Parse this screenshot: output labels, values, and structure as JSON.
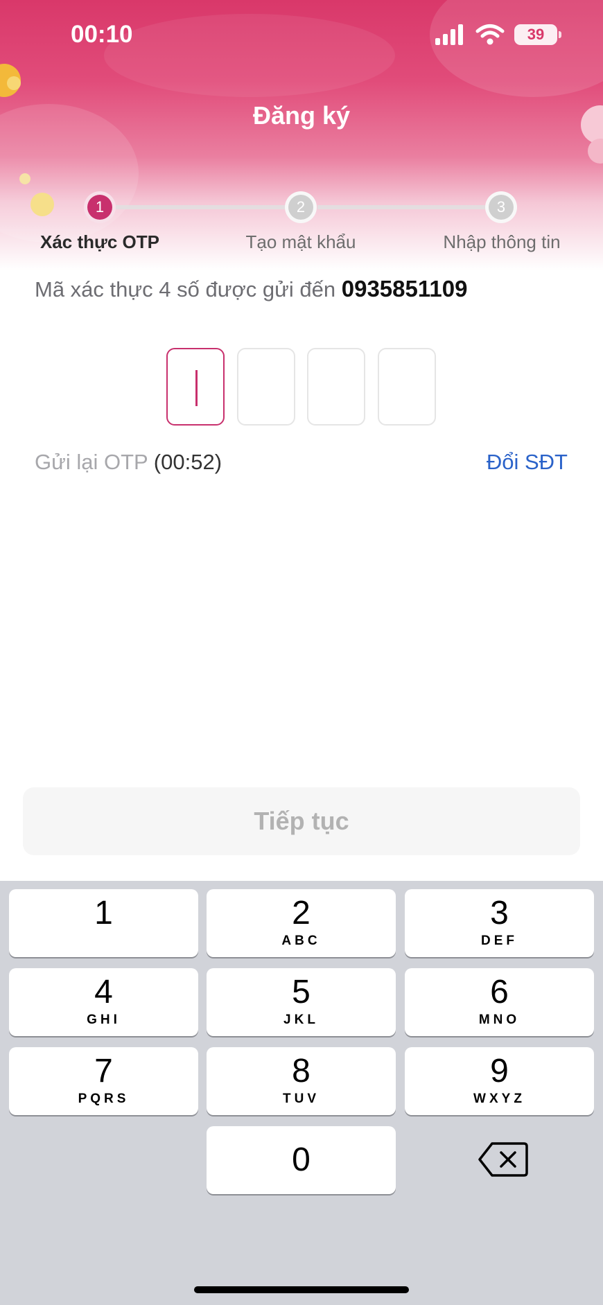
{
  "status_bar": {
    "time": "00:10",
    "battery": "39",
    "icons": [
      "signal-icon",
      "wifi-icon",
      "battery-icon"
    ]
  },
  "header": {
    "title": "Đăng ký"
  },
  "steps": [
    {
      "number": "1",
      "label": "Xác thực OTP",
      "active": true
    },
    {
      "number": "2",
      "label": "Tạo mật khẩu",
      "active": false
    },
    {
      "number": "3",
      "label": "Nhập thông tin",
      "active": false
    }
  ],
  "otp": {
    "message": "Mã xác thực 4 số được gửi đến",
    "phone": "0935851109",
    "digits": [
      "",
      "",
      "",
      ""
    ]
  },
  "resend": {
    "label": "Gửi lại OTP",
    "timer": "(00:52)"
  },
  "change_phone": "Đổi SĐT",
  "continue_label": "Tiếp tục",
  "keyboard": {
    "keys": [
      {
        "num": "1",
        "letters": ""
      },
      {
        "num": "2",
        "letters": "ABC"
      },
      {
        "num": "3",
        "letters": "DEF"
      },
      {
        "num": "4",
        "letters": "GHI"
      },
      {
        "num": "5",
        "letters": "JKL"
      },
      {
        "num": "6",
        "letters": "MNO"
      },
      {
        "num": "7",
        "letters": "PQRS"
      },
      {
        "num": "8",
        "letters": "TUV"
      },
      {
        "num": "9",
        "letters": "WXYZ"
      },
      {
        "num": "0",
        "letters": ""
      }
    ]
  },
  "colors": {
    "brand": "#c8306d",
    "link": "#2a62c9",
    "header_top": "#d9386a"
  }
}
